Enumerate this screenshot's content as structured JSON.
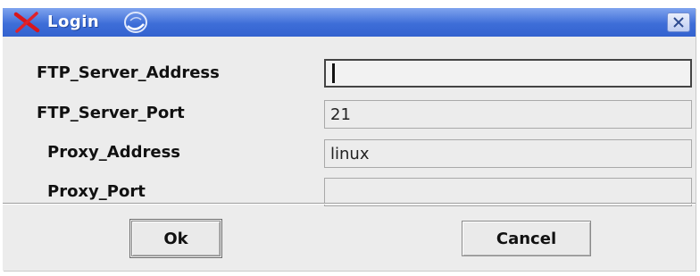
{
  "window": {
    "title": "Login",
    "app_icon": "red-x-icon",
    "title_decoration": "swirl-icon",
    "close_icon": "close-icon"
  },
  "form": {
    "fields": [
      {
        "label": "FTP_Server_Address",
        "value": ""
      },
      {
        "label": "FTP_Server_Port",
        "value": "21"
      },
      {
        "label": "Proxy_Address",
        "value": "linux"
      },
      {
        "label": "Proxy_Port",
        "value": ""
      }
    ]
  },
  "buttons": {
    "ok": "Ok",
    "cancel": "Cancel"
  },
  "colors": {
    "titlebar": "#3e6ed8",
    "window_bg": "#ececec"
  }
}
